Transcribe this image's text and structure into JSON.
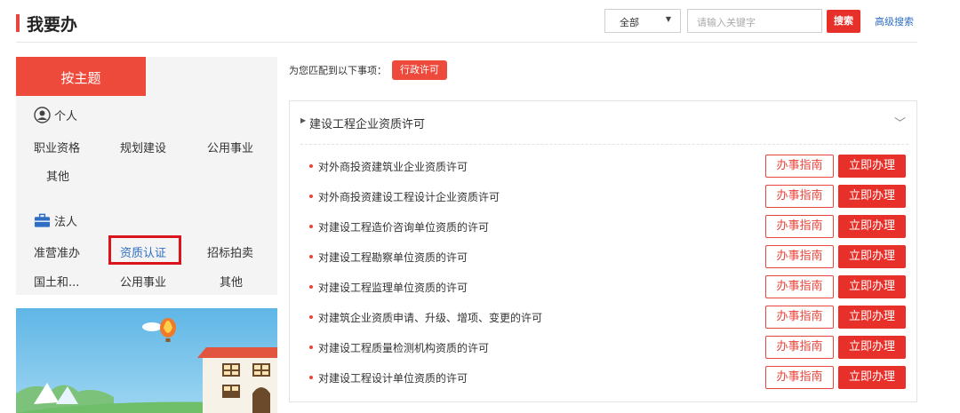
{
  "header": {
    "title": "我要办",
    "scope_select": "全部",
    "search_placeholder": "请输入关键字",
    "search_button": "搜索",
    "advanced_search": "高级搜索"
  },
  "sidebar": {
    "tab": "按主题",
    "personal": {
      "label": "个人",
      "items": [
        "职业资格",
        "规划建设",
        "公用事业",
        "其他"
      ]
    },
    "legal": {
      "label": "法人",
      "items": [
        "准营准办",
        "资质认证",
        "招标拍卖",
        "国土和...",
        "公用事业",
        "其他"
      ]
    },
    "selected_item": "资质认证"
  },
  "main": {
    "match_prefix": "为您匹配到以下事项：",
    "match_tag": "行政许可",
    "category": "建设工程企业资质许可",
    "guide_label": "办事指南",
    "apply_label": "立即办理",
    "items": [
      "对外商投资建筑业企业资质许可",
      "对外商投资建设工程设计企业资质许可",
      "对建设工程造价咨询单位资质的许可",
      "对建设工程勘察单位资质的许可",
      "对建设工程监理单位资质的许可",
      "对建筑企业资质申请、升级、增项、变更的许可",
      "对建设工程质量检测机构资质的许可",
      "对建设工程设计单位资质的许可"
    ]
  },
  "icons": {
    "personal": "person-circle-icon",
    "legal": "briefcase-icon",
    "expand": "triangle-right-icon",
    "collapse": "chevron-down-icon",
    "select_caret": "caret-down-icon"
  },
  "colors": {
    "accent": "#e8302a",
    "link": "#2f6fc3",
    "highlight": "#d9141b"
  }
}
